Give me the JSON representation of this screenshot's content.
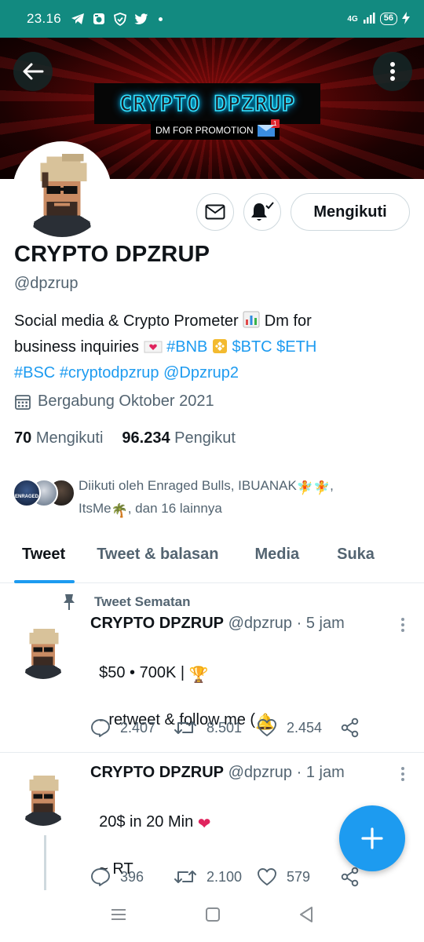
{
  "status_bar": {
    "time": "23.16",
    "network": "4G",
    "battery": "56",
    "color": "#128a80"
  },
  "banner": {
    "title": "CRYPTO DPZRUP",
    "promo": "DM FOR PROMOTION",
    "mail_badge": "1"
  },
  "profile": {
    "name": "CRYPTO DPZRUP",
    "handle": "@dpzrup",
    "follow_button": "Mengikuti",
    "bio": {
      "line1_text": "Social media & Crypto Prometer",
      "line1_after": "Dm for",
      "line2_text": "business  inquiries",
      "tags_line2": [
        "#BNB",
        "$BTC",
        "$ETH"
      ],
      "tags_line3": [
        "#BSC",
        "#cryptodpzrup",
        "@Dpzrup2"
      ]
    },
    "joined": "Bergabung Oktober 2021",
    "following_count": "70",
    "following_label": "Mengikuti",
    "followers_count": "96.234",
    "followers_label": "Pengikut",
    "followed_by_line1": "Diikuti oleh Enraged Bulls, IBUANAK",
    "followed_by_line2_a": "ItsMe",
    "followed_by_line2_b": ", dan 16 lainnya",
    "enraged_label": "ENRAGED"
  },
  "tabs": [
    {
      "label": "Tweet"
    },
    {
      "label": "Tweet & balasan"
    },
    {
      "label": "Media"
    },
    {
      "label": "Suka"
    }
  ],
  "tweets": [
    {
      "pinned_label": "Tweet Sematan",
      "name": "CRYPTO DPZRUP",
      "meta": "@dpzrup · 5 jam",
      "line1": "$50 • 700K | ",
      "line3": "- retweet & follow me (",
      "replies": "2.407",
      "retweets": "8.501",
      "likes": "2.454"
    },
    {
      "name": "CRYPTO DPZRUP",
      "meta": "@dpzrup · 1 jam",
      "line1": "20$ in 20 Min ",
      "line3": "~ RT",
      "replies": "396",
      "retweets": "2.100",
      "likes": "579"
    }
  ],
  "colors": {
    "accent": "#1d9bf0",
    "text": "#0f1419",
    "secondary": "#536471"
  }
}
